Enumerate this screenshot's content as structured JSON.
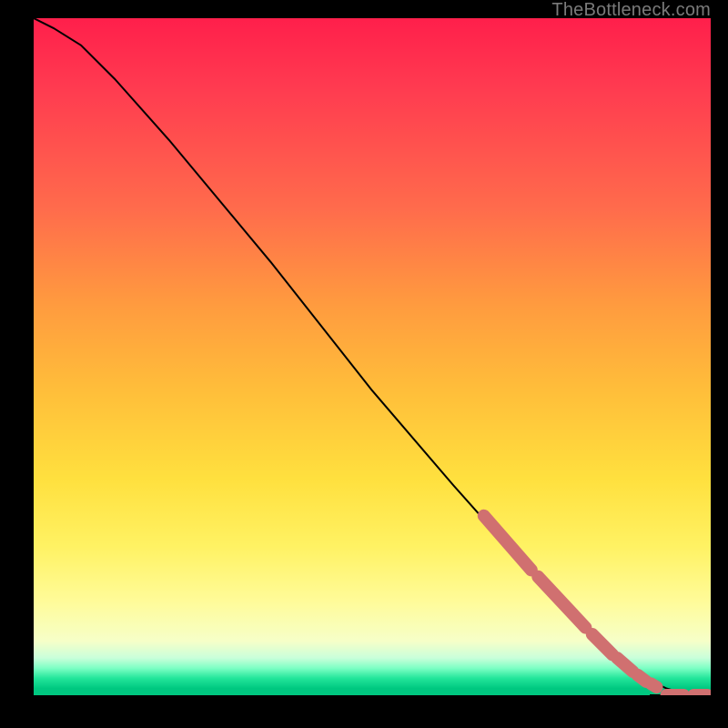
{
  "watermark": "TheBottleneck.com",
  "colors": {
    "marker": "#d07070",
    "curve": "#000000",
    "gradient_top": "#ff1f4b",
    "gradient_bottom": "#00c880"
  },
  "chart_data": {
    "type": "line",
    "title": "",
    "xlabel": "",
    "ylabel": "",
    "xlim": [
      0,
      1
    ],
    "ylim": [
      0,
      1
    ],
    "grid": false,
    "legend": false,
    "note": "Axes unlabeled; values normalized 0–1 from pixel geometry (x left→right, y bottom→top).",
    "series": [
      {
        "name": "curve",
        "note": "Smooth monotonically-decreasing black curve with a slight ease at top-left, near-linear middle, flattening to zero at right.",
        "x": [
          0.0,
          0.03,
          0.07,
          0.12,
          0.2,
          0.35,
          0.5,
          0.62,
          0.7,
          0.78,
          0.84,
          0.88,
          0.91,
          0.935,
          0.96,
          0.98,
          1.0
        ],
        "y": [
          1.0,
          0.985,
          0.96,
          0.91,
          0.82,
          0.64,
          0.45,
          0.31,
          0.22,
          0.14,
          0.08,
          0.045,
          0.022,
          0.01,
          0.003,
          0.001,
          0.0
        ]
      },
      {
        "name": "highlighted-points",
        "note": "Salmon/pink dashed marker segments overlaid on the curve near the bottom-right — clusters of thick rounded segments along the tail, plus two short flat segments on the baseline.",
        "clusters": [
          {
            "x_start": 0.665,
            "x_end": 0.735,
            "y_start": 0.265,
            "y_end": 0.185
          },
          {
            "x_start": 0.745,
            "x_end": 0.815,
            "y_start": 0.175,
            "y_end": 0.1
          },
          {
            "x_start": 0.825,
            "x_end": 0.855,
            "y_start": 0.09,
            "y_end": 0.06
          },
          {
            "x_start": 0.862,
            "x_end": 0.885,
            "y_start": 0.055,
            "y_end": 0.035
          },
          {
            "x_start": 0.892,
            "x_end": 0.905,
            "y_start": 0.03,
            "y_end": 0.02
          },
          {
            "x_start": 0.912,
            "x_end": 0.92,
            "y_start": 0.017,
            "y_end": 0.012
          },
          {
            "x_start": 0.935,
            "x_end": 0.96,
            "y_start": 0.0,
            "y_end": 0.0
          },
          {
            "x_start": 0.975,
            "x_end": 0.995,
            "y_start": 0.0,
            "y_end": 0.0
          }
        ]
      }
    ]
  }
}
